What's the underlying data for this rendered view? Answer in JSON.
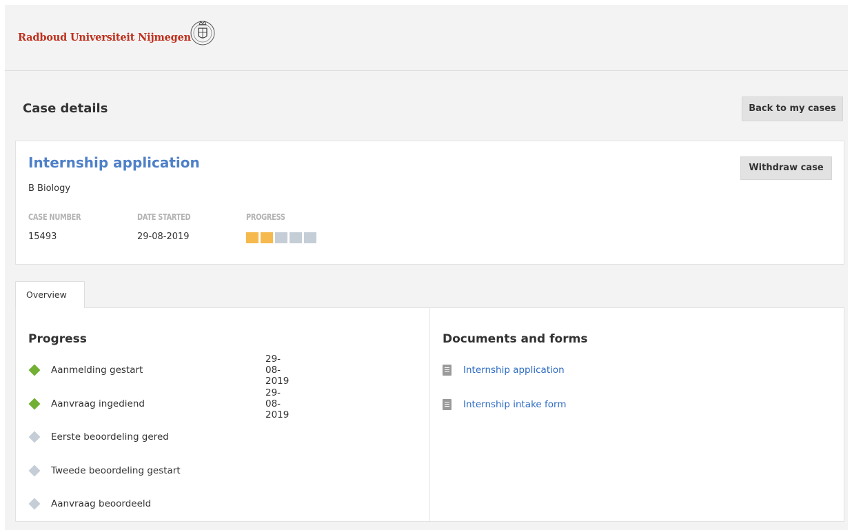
{
  "header": {
    "brand": "Radboud Universiteit Nijmegen"
  },
  "page": {
    "title": "Case details",
    "back_label": "Back to my cases"
  },
  "case": {
    "title": "Internship application",
    "subtitle": "B Biology",
    "withdraw_label": "Withdraw case",
    "labels": {
      "case_number": "CASE NUMBER",
      "date_started": "DATE STARTED",
      "progress": "PROGRESS"
    },
    "case_number": "15493",
    "date_started": "29-08-2019",
    "progress": {
      "completed": 2,
      "total": 5
    },
    "colors": {
      "done": "#f5b94d",
      "pending": "#c5ced6"
    }
  },
  "tabs": [
    {
      "label": "Overview",
      "active": true
    }
  ],
  "overview": {
    "progress_title": "Progress",
    "steps": [
      {
        "label": "Aanmelding gestart",
        "date": "29-08-2019",
        "done": true
      },
      {
        "label": "Aanvraag ingediend",
        "date": "29-08-2019",
        "done": true
      },
      {
        "label": "Eerste beoordeling gered",
        "date": "",
        "done": false
      },
      {
        "label": "Tweede beoordeling gestart",
        "date": "",
        "done": false
      },
      {
        "label": "Aanvraag beoordeeld",
        "date": "",
        "done": false
      }
    ],
    "documents_title": "Documents and forms",
    "documents": [
      {
        "label": "Internship application",
        "icon": "document-icon"
      },
      {
        "label": "Internship intake form",
        "icon": "document-icon"
      }
    ],
    "colors": {
      "step_done": "#72b034",
      "step_pending": "#c5ced6",
      "link": "#2d6bc4"
    }
  }
}
